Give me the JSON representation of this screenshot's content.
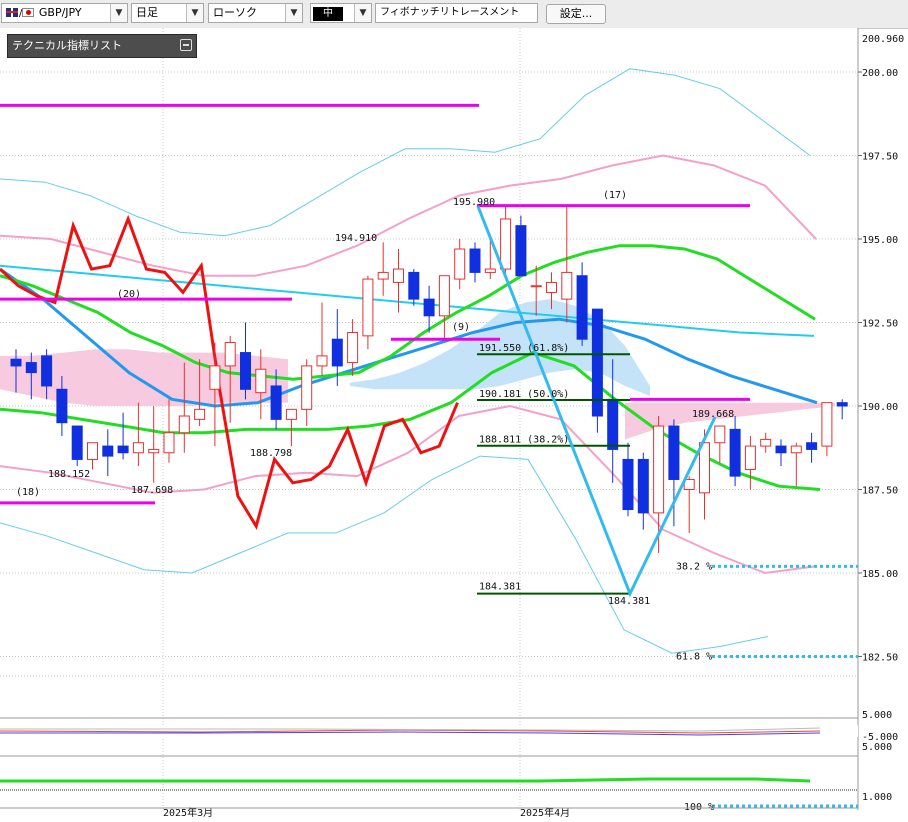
{
  "toolbar": {
    "symbol": "GBP/JPY",
    "timeframe": "日足",
    "chart_type": "ローソク",
    "size": "中",
    "drawing_tool": "フィボナッチリトレースメント",
    "settings_label": "設定..."
  },
  "indicator_panel": {
    "title": "テクニカル指標リスト"
  },
  "colors": {
    "bull_candle": "#e83030",
    "bear_candle": "#1030e0",
    "line_chart": "#ee1111",
    "ma_green": "#22dd22",
    "ma_cyan": "#22ccee",
    "ma_blue": "#2299ee",
    "bollinger_pink": "#f5a0c8",
    "bollinger_cyan": "#66ccee",
    "ichimoku_cloud": "#f7c4dc",
    "ichimoku_cloud_blue": "#bfe0f7",
    "magenta_line": "#ee00ee",
    "fib_line": "#005500",
    "fib_zigzag": "#33bbee"
  },
  "chart_data": {
    "type": "candlestick",
    "symbol": "GBP/JPY",
    "timeframe": "日足",
    "y_axis_ticks": [
      "200.960",
      "200.00",
      "197.50",
      "195.00",
      "192.50",
      "190.00",
      "187.50",
      "185.00",
      "182.50"
    ],
    "ylim": [
      181.0,
      201.0
    ],
    "x_axis_labels": [
      "2025年3月",
      "2025年4月"
    ],
    "price_annotations": [
      "188.152",
      "187.698",
      "188.798",
      "194.910",
      "195.980",
      "189.668",
      "184.381"
    ],
    "fibonacci": {
      "high": 195.98,
      "low": 184.381,
      "levels": [
        {
          "label": "191.550 (61.8%)",
          "value": 191.55
        },
        {
          "label": "190.181 (50.0%)",
          "value": 190.181
        },
        {
          "label": "188.811 (38.2%)",
          "value": 188.811
        },
        {
          "label": "184.381",
          "value": 184.381
        }
      ],
      "projection_labels": [
        "38.2 %",
        "61.8 %",
        "100 %"
      ]
    },
    "period_labels": [
      "(20)",
      "(18)",
      "(9)",
      "(17)"
    ],
    "lower_indicator_ticks": [
      "5.000",
      "-5.000",
      "5.000",
      "1.000"
    ],
    "candles": [
      {
        "o": 191.4,
        "h": 191.7,
        "l": 190.4,
        "c": 191.2
      },
      {
        "o": 191.3,
        "h": 191.6,
        "l": 190.2,
        "c": 191.0
      },
      {
        "o": 191.5,
        "h": 191.7,
        "l": 190.2,
        "c": 190.6
      },
      {
        "o": 190.5,
        "h": 190.9,
        "l": 189.1,
        "c": 189.5
      },
      {
        "o": 189.4,
        "h": 189.4,
        "l": 188.2,
        "c": 188.4
      },
      {
        "o": 188.4,
        "h": 188.9,
        "l": 188.1,
        "c": 188.9
      },
      {
        "o": 188.8,
        "h": 189.3,
        "l": 187.9,
        "c": 188.5
      },
      {
        "o": 188.8,
        "h": 189.8,
        "l": 188.4,
        "c": 188.6
      },
      {
        "o": 188.6,
        "h": 190.1,
        "l": 188.2,
        "c": 188.9
      },
      {
        "o": 188.6,
        "h": 190.0,
        "l": 187.7,
        "c": 188.7
      },
      {
        "o": 188.6,
        "h": 190.2,
        "l": 188.3,
        "c": 189.2
      },
      {
        "o": 189.2,
        "h": 191.3,
        "l": 188.6,
        "c": 189.7
      },
      {
        "o": 189.6,
        "h": 191.4,
        "l": 189.4,
        "c": 189.9
      },
      {
        "o": 190.5,
        "h": 191.9,
        "l": 188.8,
        "c": 191.2
      },
      {
        "o": 191.2,
        "h": 192.1,
        "l": 189.5,
        "c": 191.9
      },
      {
        "o": 191.6,
        "h": 192.5,
        "l": 190.2,
        "c": 190.5
      },
      {
        "o": 190.4,
        "h": 191.7,
        "l": 189.6,
        "c": 191.1
      },
      {
        "o": 190.6,
        "h": 191.1,
        "l": 189.3,
        "c": 189.6
      },
      {
        "o": 189.6,
        "h": 189.9,
        "l": 188.8,
        "c": 189.9
      },
      {
        "o": 189.9,
        "h": 191.4,
        "l": 189.4,
        "c": 191.2
      },
      {
        "o": 191.2,
        "h": 193.1,
        "l": 190.9,
        "c": 191.5
      },
      {
        "o": 192.0,
        "h": 192.9,
        "l": 190.6,
        "c": 191.2
      },
      {
        "o": 191.3,
        "h": 192.6,
        "l": 190.9,
        "c": 192.2
      },
      {
        "o": 192.1,
        "h": 193.9,
        "l": 191.7,
        "c": 193.8
      },
      {
        "o": 193.8,
        "h": 194.9,
        "l": 193.3,
        "c": 194.0
      },
      {
        "o": 193.7,
        "h": 194.7,
        "l": 192.8,
        "c": 194.1
      },
      {
        "o": 194.0,
        "h": 194.1,
        "l": 193.0,
        "c": 193.2
      },
      {
        "o": 193.2,
        "h": 193.6,
        "l": 192.2,
        "c": 192.7
      },
      {
        "o": 192.7,
        "h": 193.9,
        "l": 192.0,
        "c": 193.9
      },
      {
        "o": 193.8,
        "h": 195.0,
        "l": 193.5,
        "c": 194.7
      },
      {
        "o": 194.7,
        "h": 194.9,
        "l": 193.7,
        "c": 194.0
      },
      {
        "o": 194.0,
        "h": 195.0,
        "l": 193.8,
        "c": 194.1
      },
      {
        "o": 194.1,
        "h": 195.98,
        "l": 193.9,
        "c": 195.6
      },
      {
        "o": 195.4,
        "h": 195.7,
        "l": 193.9,
        "c": 193.9
      },
      {
        "o": 193.6,
        "h": 194.2,
        "l": 192.7,
        "c": 193.6
      },
      {
        "o": 193.4,
        "h": 194.0,
        "l": 192.9,
        "c": 193.7
      },
      {
        "o": 193.2,
        "h": 196.0,
        "l": 192.5,
        "c": 194.0
      },
      {
        "o": 193.9,
        "h": 194.3,
        "l": 191.8,
        "c": 192.0
      },
      {
        "o": 192.9,
        "h": 192.9,
        "l": 189.2,
        "c": 189.7
      },
      {
        "o": 190.2,
        "h": 191.4,
        "l": 187.7,
        "c": 188.7
      },
      {
        "o": 188.4,
        "h": 188.9,
        "l": 186.7,
        "c": 186.9
      },
      {
        "o": 188.4,
        "h": 188.6,
        "l": 186.3,
        "c": 186.8
      },
      {
        "o": 186.8,
        "h": 189.7,
        "l": 185.6,
        "c": 189.4
      },
      {
        "o": 189.4,
        "h": 189.6,
        "l": 186.4,
        "c": 187.8
      },
      {
        "o": 187.5,
        "h": 187.9,
        "l": 186.2,
        "c": 187.8
      },
      {
        "o": 187.4,
        "h": 189.3,
        "l": 186.6,
        "c": 188.9
      },
      {
        "o": 188.9,
        "h": 189.4,
        "l": 188.3,
        "c": 189.4
      },
      {
        "o": 189.3,
        "h": 189.7,
        "l": 187.6,
        "c": 187.9
      },
      {
        "o": 188.1,
        "h": 189.1,
        "l": 187.5,
        "c": 188.8
      },
      {
        "o": 188.8,
        "h": 189.2,
        "l": 188.6,
        "c": 189.0
      },
      {
        "o": 188.8,
        "h": 189.0,
        "l": 188.2,
        "c": 188.6
      },
      {
        "o": 188.6,
        "h": 188.9,
        "l": 187.6,
        "c": 188.8
      },
      {
        "o": 188.9,
        "h": 189.2,
        "l": 188.3,
        "c": 188.7
      },
      {
        "o": 188.8,
        "h": 190.1,
        "l": 188.5,
        "c": 190.1
      },
      {
        "o": 190.1,
        "h": 190.2,
        "l": 189.6,
        "c": 190.0
      }
    ],
    "line_series": [
      194.1,
      193.6,
      193.3,
      193.1,
      195.4,
      194.1,
      194.2,
      195.6,
      194.1,
      194.0,
      193.4,
      194.2,
      190.5,
      187.3,
      186.4,
      188.4,
      187.7,
      187.8,
      188.2,
      189.3,
      187.7,
      189.4,
      189.6,
      188.6,
      188.8,
      190.1
    ],
    "ma_green_series": [
      193.9,
      193.6,
      193.2,
      192.8,
      192.2,
      191.8,
      191.3,
      191.0,
      190.9,
      190.8,
      190.9,
      191.0,
      191.5,
      192.2,
      192.8,
      193.3,
      193.9,
      194.3,
      194.6,
      194.8,
      194.8,
      194.7,
      194.4,
      193.8,
      193.2,
      192.6
    ],
    "ma_cyan_series": [
      194.2,
      194.1,
      194.0,
      193.9,
      193.8,
      193.7,
      193.6,
      193.5,
      193.4,
      193.3,
      193.2,
      193.1,
      193.0,
      192.9,
      192.8,
      192.7,
      192.6,
      192.5,
      192.4,
      192.3,
      192.2,
      192.15,
      192.1
    ],
    "ma_blue_series": [
      194.1,
      193.2,
      192.1,
      191.0,
      190.2,
      190.0,
      190.1,
      190.6,
      191.0,
      191.4,
      191.8,
      192.2,
      192.5,
      192.6,
      192.4,
      192.0,
      191.4,
      190.9,
      190.5,
      190.1
    ],
    "bb_upper_outer": [
      196.8,
      196.7,
      196.3,
      195.7,
      195.2,
      195.1,
      195.4,
      196.2,
      197.0,
      197.7,
      197.7,
      197.6,
      198.0,
      199.3,
      200.1,
      199.9,
      199.5,
      198.5,
      197.5
    ],
    "bb_upper_inner": [
      195.1,
      195.0,
      194.6,
      194.2,
      193.9,
      193.9,
      194.2,
      194.8,
      195.6,
      196.3,
      196.6,
      196.8,
      197.2,
      197.5,
      197.2,
      196.6,
      195.0
    ],
    "bb_lower_inner": [
      188.2,
      188.0,
      187.7,
      187.4,
      187.5,
      187.9,
      188.0,
      187.9,
      188.6,
      189.7,
      190.0,
      189.6,
      188.0,
      186.3,
      185.6,
      185.0,
      185.2
    ],
    "bb_lower_outer": [
      186.5,
      186.1,
      185.6,
      185.1,
      185.0,
      185.6,
      186.2,
      186.2,
      186.8,
      187.8,
      188.5,
      188.4,
      186.0,
      183.3,
      182.6,
      182.8,
      183.1
    ],
    "lower_green_series": [
      1.9,
      1.9,
      1.9,
      1.9,
      1.9,
      1.9,
      1.9,
      1.9,
      1.9,
      1.9,
      1.9,
      2.0,
      2.1,
      2.1,
      2.1,
      1.9
    ]
  }
}
